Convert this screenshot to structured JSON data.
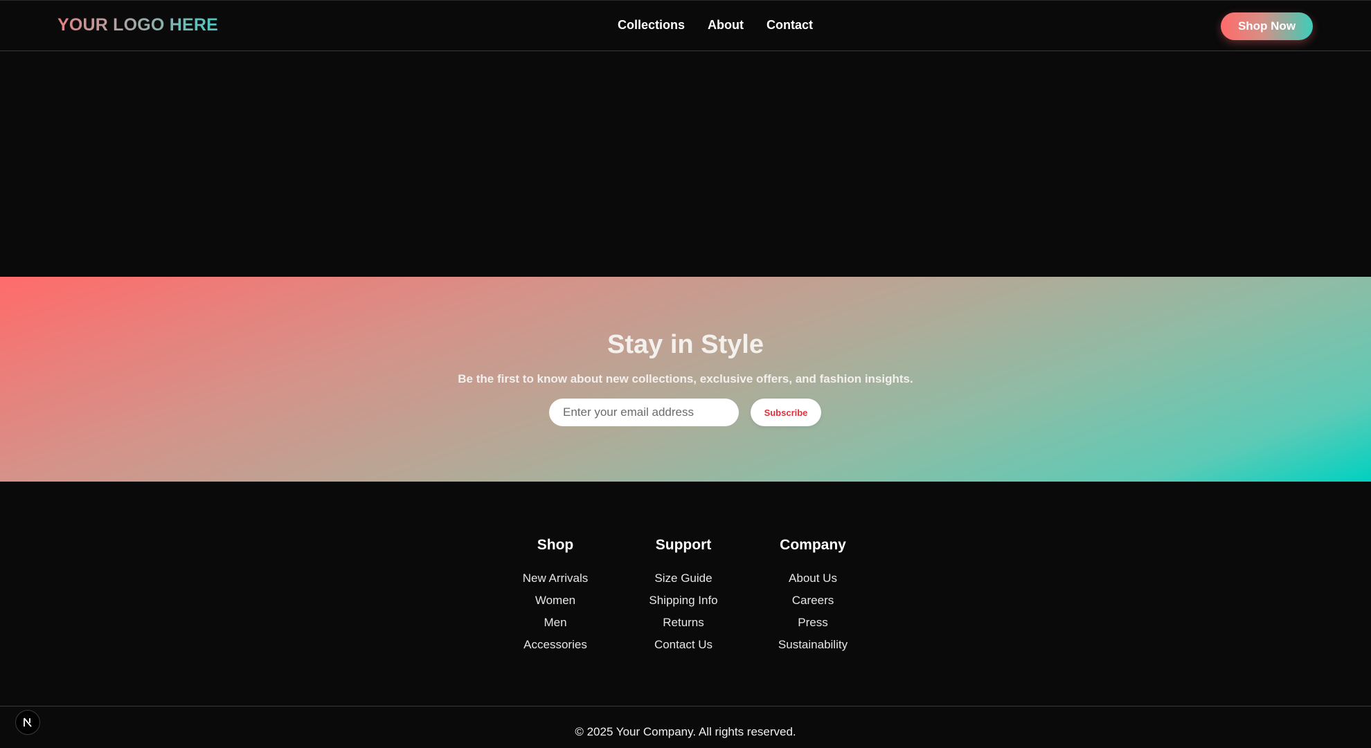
{
  "header": {
    "logo": "YOUR LOGO HERE",
    "nav": [
      "Collections",
      "About",
      "Contact"
    ],
    "cta": "Shop Now"
  },
  "newsletter": {
    "title": "Stay in Style",
    "subtitle": "Be the first to know about new collections, exclusive offers, and fashion insights.",
    "email_placeholder": "Enter your email address",
    "email_value": "",
    "subscribe_label": "Subscribe"
  },
  "footer": {
    "columns": [
      {
        "title": "Shop",
        "links": [
          "New Arrivals",
          "Women",
          "Men",
          "Accessories"
        ]
      },
      {
        "title": "Support",
        "links": [
          "Size Guide",
          "Shipping Info",
          "Returns",
          "Contact Us"
        ]
      },
      {
        "title": "Company",
        "links": [
          "About Us",
          "Careers",
          "Press",
          "Sustainability"
        ]
      }
    ],
    "copyright": "© 2025 Your Company. All rights reserved."
  },
  "dev_badge": {
    "icon": "nextjs-logo-icon"
  },
  "colors": {
    "background": "#0a0a0b",
    "accent_coral": "#ff6b6b",
    "accent_teal": "#00d1c0",
    "subscribe_text": "#e0303c"
  }
}
